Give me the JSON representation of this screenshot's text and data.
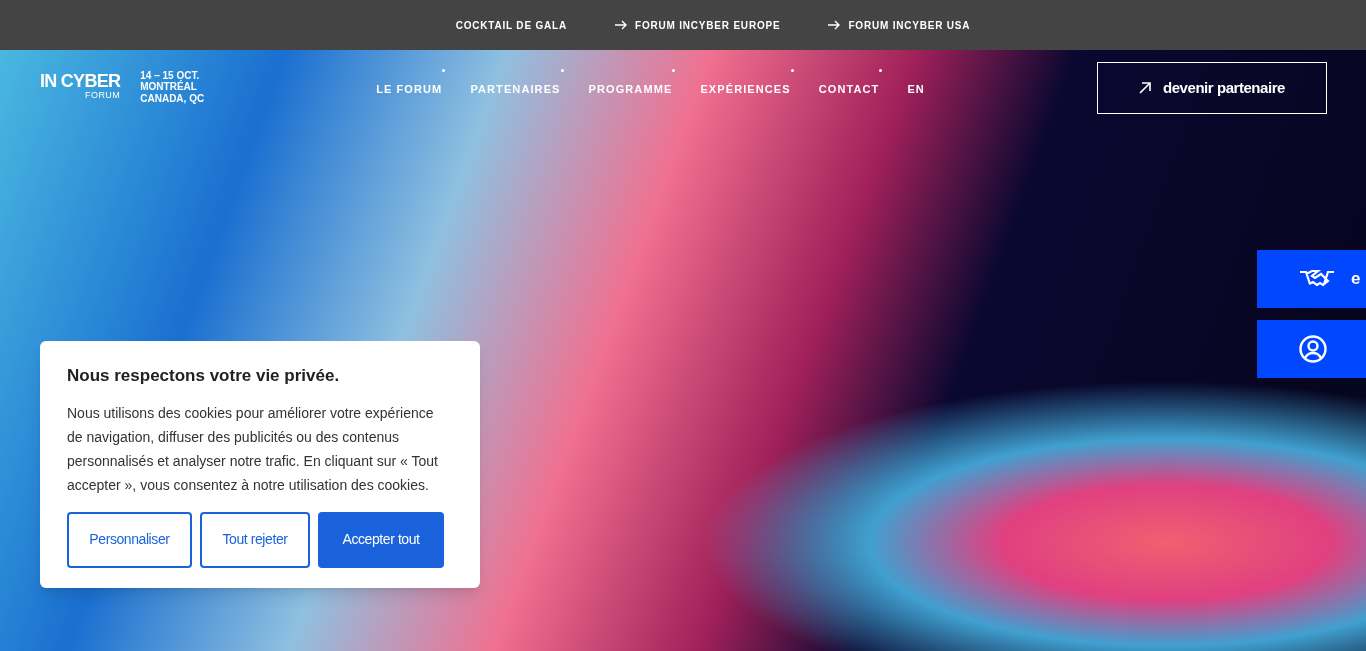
{
  "top_bar": {
    "links": [
      {
        "label": "COCKTAIL DE GALA",
        "arrow": false
      },
      {
        "label": "FORUM INCYBER EUROPE",
        "arrow": true
      },
      {
        "label": "FORUM INCYBER USA",
        "arrow": true
      }
    ]
  },
  "header": {
    "logo": {
      "name": "IN CYBER",
      "sub": "FORUM"
    },
    "event": [
      "14 – 15 OCT.",
      "MONTRÉAL",
      "CANADA, QC"
    ],
    "nav": [
      {
        "label": "LE FORUM",
        "dot": true
      },
      {
        "label": "PARTENAIRES",
        "dot": true
      },
      {
        "label": "PROGRAMME",
        "dot": true
      },
      {
        "label": "EXPÉRIENCES",
        "dot": true
      },
      {
        "label": "CONTACT",
        "dot": true
      },
      {
        "label": "EN",
        "dot": false
      }
    ],
    "cta": "devenir partenaire"
  },
  "side_tabs": [
    {
      "kind": "handshake",
      "label": "e"
    },
    {
      "kind": "user"
    }
  ],
  "cookie_banner": {
    "title": "Nous respectons votre vie privée.",
    "text": "Nous utilisons des cookies pour améliorer votre expérience de navigation, diffuser des publicités ou des contenus personnalisés et analyser notre trafic. En cliquant sur « Tout accepter », vous consentez à notre utilisation des cookies.",
    "buttons": [
      {
        "label": "Personnaliser",
        "kind": "outline"
      },
      {
        "label": "Tout rejeter",
        "kind": "outline"
      },
      {
        "label": "Accepter tout",
        "kind": "primary"
      }
    ]
  }
}
